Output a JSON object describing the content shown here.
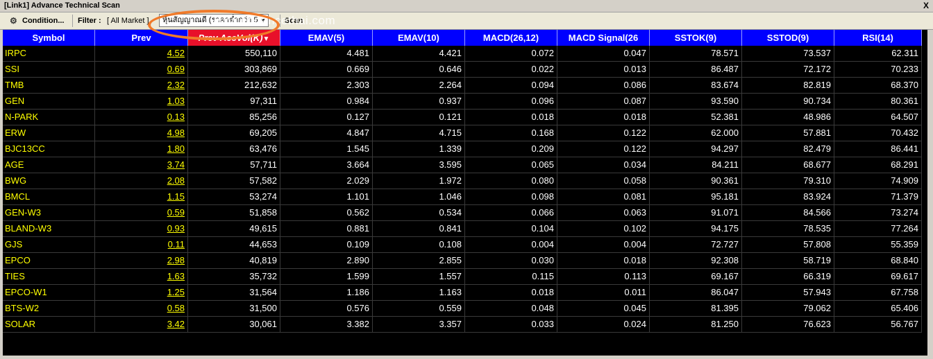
{
  "window": {
    "title": "[Link1] Advance Technical Scan",
    "close_label": "X"
  },
  "toolbar": {
    "condition_label": "Condition...",
    "filter_label": "Filter :",
    "filter_value": "[ All Market ]",
    "combo_value": "หุ้นสัญญาณดี (ราคาต่ำกว่า 5",
    "scan_label": "Scan"
  },
  "watermark": "www.efinancethai.com",
  "columns": [
    "Symbol",
    "Prev",
    "Prev AccVol(K)",
    "EMAV(5)",
    "EMAV(10)",
    "MACD(26,12)",
    "MACD Signal(26",
    "SSTOK(9)",
    "SSTOD(9)",
    "RSI(14)"
  ],
  "sorted_column_arrow": "▼",
  "rows": [
    [
      "IRPC",
      "4.52",
      "550,110",
      "4.481",
      "4.421",
      "0.072",
      "0.047",
      "78.571",
      "73.537",
      "62.311"
    ],
    [
      "SSI",
      "0.69",
      "303,869",
      "0.669",
      "0.646",
      "0.022",
      "0.013",
      "86.487",
      "72.172",
      "70.233"
    ],
    [
      "TMB",
      "2.32",
      "212,632",
      "2.303",
      "2.264",
      "0.094",
      "0.086",
      "83.674",
      "82.819",
      "68.370"
    ],
    [
      "GEN",
      "1.03",
      "97,311",
      "0.984",
      "0.937",
      "0.096",
      "0.087",
      "93.590",
      "90.734",
      "80.361"
    ],
    [
      "N-PARK",
      "0.13",
      "85,256",
      "0.127",
      "0.121",
      "0.018",
      "0.018",
      "52.381",
      "48.986",
      "64.507"
    ],
    [
      "ERW",
      "4.98",
      "69,205",
      "4.847",
      "4.715",
      "0.168",
      "0.122",
      "62.000",
      "57.881",
      "70.432"
    ],
    [
      "BJC13CC",
      "1.80",
      "63,476",
      "1.545",
      "1.339",
      "0.209",
      "0.122",
      "94.297",
      "82.479",
      "86.441"
    ],
    [
      "AGE",
      "3.74",
      "57,711",
      "3.664",
      "3.595",
      "0.065",
      "0.034",
      "84.211",
      "68.677",
      "68.291"
    ],
    [
      "BWG",
      "2.08",
      "57,582",
      "2.029",
      "1.972",
      "0.080",
      "0.058",
      "90.361",
      "79.310",
      "74.909"
    ],
    [
      "BMCL",
      "1.15",
      "53,274",
      "1.101",
      "1.046",
      "0.098",
      "0.081",
      "95.181",
      "83.924",
      "71.379"
    ],
    [
      "GEN-W3",
      "0.59",
      "51,858",
      "0.562",
      "0.534",
      "0.066",
      "0.063",
      "91.071",
      "84.566",
      "73.274"
    ],
    [
      "BLAND-W3",
      "0.93",
      "49,615",
      "0.881",
      "0.841",
      "0.104",
      "0.102",
      "94.175",
      "78.535",
      "77.264"
    ],
    [
      "GJS",
      "0.11",
      "44,653",
      "0.109",
      "0.108",
      "0.004",
      "0.004",
      "72.727",
      "57.808",
      "55.359"
    ],
    [
      "EPCO",
      "2.98",
      "40,819",
      "2.890",
      "2.855",
      "0.030",
      "0.018",
      "92.308",
      "58.719",
      "68.840"
    ],
    [
      "TIES",
      "1.63",
      "35,732",
      "1.599",
      "1.557",
      "0.115",
      "0.113",
      "69.167",
      "66.319",
      "69.617"
    ],
    [
      "EPCO-W1",
      "1.25",
      "31,564",
      "1.186",
      "1.163",
      "0.018",
      "0.011",
      "86.047",
      "57.943",
      "67.758"
    ],
    [
      "BTS-W2",
      "0.58",
      "31,500",
      "0.576",
      "0.559",
      "0.048",
      "0.045",
      "81.395",
      "79.062",
      "65.406"
    ],
    [
      "SOLAR",
      "3.42",
      "30,061",
      "3.382",
      "3.357",
      "0.033",
      "0.024",
      "81.250",
      "76.623",
      "56.767"
    ]
  ],
  "colors": {
    "header_bg": "#0000ff",
    "sorted_header_bg": "#e8102a",
    "grid_bg": "#000000",
    "symbol_text": "#ffff00",
    "value_text": "#ffffff",
    "highlight_oval": "#f07a2a"
  }
}
